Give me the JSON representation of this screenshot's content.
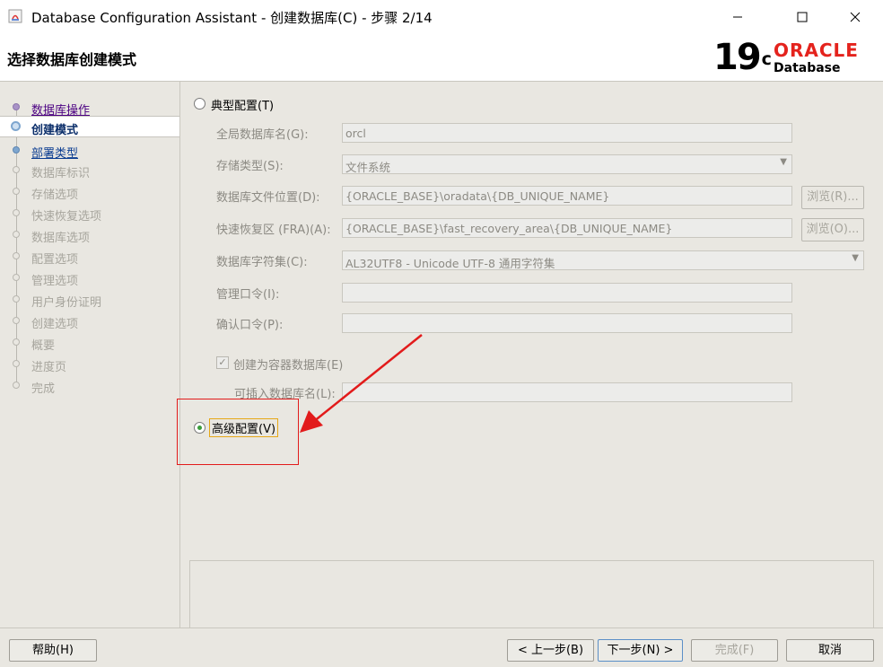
{
  "window": {
    "title": "Database Configuration Assistant - 创建数据库(C) - 步骤 2/14"
  },
  "header": {
    "step_title": "选择数据库创建模式",
    "logo_version": "19",
    "logo_suffix": "c",
    "logo_brand": "ORACLE",
    "logo_product": "Database"
  },
  "nav": {
    "items": [
      {
        "label": "数据库操作"
      },
      {
        "label": "创建模式"
      },
      {
        "label": "部署类型"
      },
      {
        "label": "数据库标识"
      },
      {
        "label": "存储选项"
      },
      {
        "label": "快速恢复选项"
      },
      {
        "label": "数据库选项"
      },
      {
        "label": "配置选项"
      },
      {
        "label": "管理选项"
      },
      {
        "label": "用户身份证明"
      },
      {
        "label": "创建选项"
      },
      {
        "label": "概要"
      },
      {
        "label": "进度页"
      },
      {
        "label": "完成"
      }
    ]
  },
  "typical": {
    "radio_label": "典型配置(T)",
    "global_db_name_label": "全局数据库名(G):",
    "global_db_name_value": "orcl",
    "storage_type_label": "存储类型(S):",
    "storage_type_value": "文件系统",
    "db_file_location_label": "数据库文件位置(D):",
    "db_file_location_value": "{ORACLE_BASE}\\oradata\\{DB_UNIQUE_NAME}",
    "browse_r_label": "浏览(R)...",
    "fra_label": "快速恢复区 (FRA)(A):",
    "fra_value": "{ORACLE_BASE}\\fast_recovery_area\\{DB_UNIQUE_NAME}",
    "browse_o_label": "浏览(O)...",
    "charset_label": "数据库字符集(C):",
    "charset_value": "AL32UTF8 - Unicode UTF-8 通用字符集",
    "admin_pwd_label": "管理口令(I):",
    "confirm_pwd_label": "确认口令(P):",
    "container_db_label": "创建为容器数据库(E)",
    "pdb_name_label": "可插入数据库名(L):"
  },
  "advanced": {
    "radio_label": "高级配置(V)"
  },
  "footer": {
    "help_label": "帮助(H)",
    "back_label": "< 上一步(B)",
    "next_label": "下一步(N) >",
    "finish_label": "完成(F)",
    "cancel_label": "取消"
  },
  "colors": {
    "annotation_red": "#e21b1b",
    "oracle_red": "#e4231d",
    "focus_border": "#e6a817"
  }
}
